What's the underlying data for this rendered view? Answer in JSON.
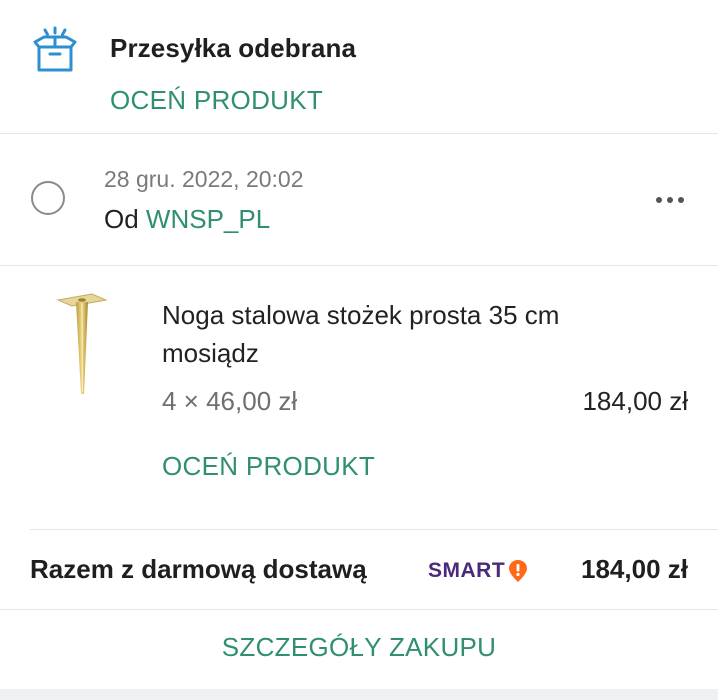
{
  "shipment": {
    "status_title": "Przesyłka odebrana",
    "rate_link": "OCEŃ PRODUKT",
    "icon": "package-box-icon"
  },
  "order": {
    "date": "28 gru. 2022, 20:02",
    "seller_prefix": "Od ",
    "seller_name": "WNSP_PL",
    "more_icon": "more-dots-icon"
  },
  "product": {
    "name": "Noga stalowa stożek prosta 35 cm mosiądz",
    "quantity_price": "4 × 46,00 zł",
    "total": "184,00 zł",
    "rate_link": "OCEŃ PRODUKT",
    "thumbnail_icon": "brass-leg-thumbnail"
  },
  "summary": {
    "label": "Razem z darmową dostawą",
    "badge_text": "SMART",
    "total": "184,00 zł"
  },
  "footer": {
    "details_link": "SZCZEGÓŁY ZAKUPU"
  },
  "colors": {
    "accent_green": "#2f8f6f",
    "smart_purple": "#4a2a7a",
    "smart_orange": "#ff6a1a",
    "icon_blue": "#2b8fd0"
  }
}
